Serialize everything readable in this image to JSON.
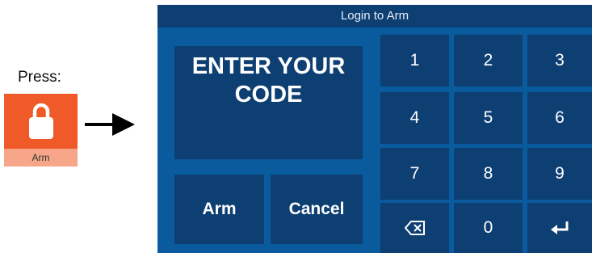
{
  "instruction": {
    "press_label": "Press:",
    "tile_label": "Arm",
    "tile_icon": "lock-icon",
    "tile_color": "#f05a28"
  },
  "panel": {
    "title": "Login to Arm",
    "prompt_line1": "ENTER YOUR",
    "prompt_line2": "CODE",
    "arm_label": "Arm",
    "cancel_label": "Cancel",
    "keys": {
      "k1": "1",
      "k2": "2",
      "k3": "3",
      "k4": "4",
      "k5": "5",
      "k6": "6",
      "k7": "7",
      "k8": "8",
      "k9": "9",
      "k0": "0"
    },
    "backspace_icon": "backspace-icon",
    "enter_icon": "enter-icon",
    "colors": {
      "panel_bg": "#0a5a9e",
      "button_bg": "#0d3f73"
    }
  }
}
